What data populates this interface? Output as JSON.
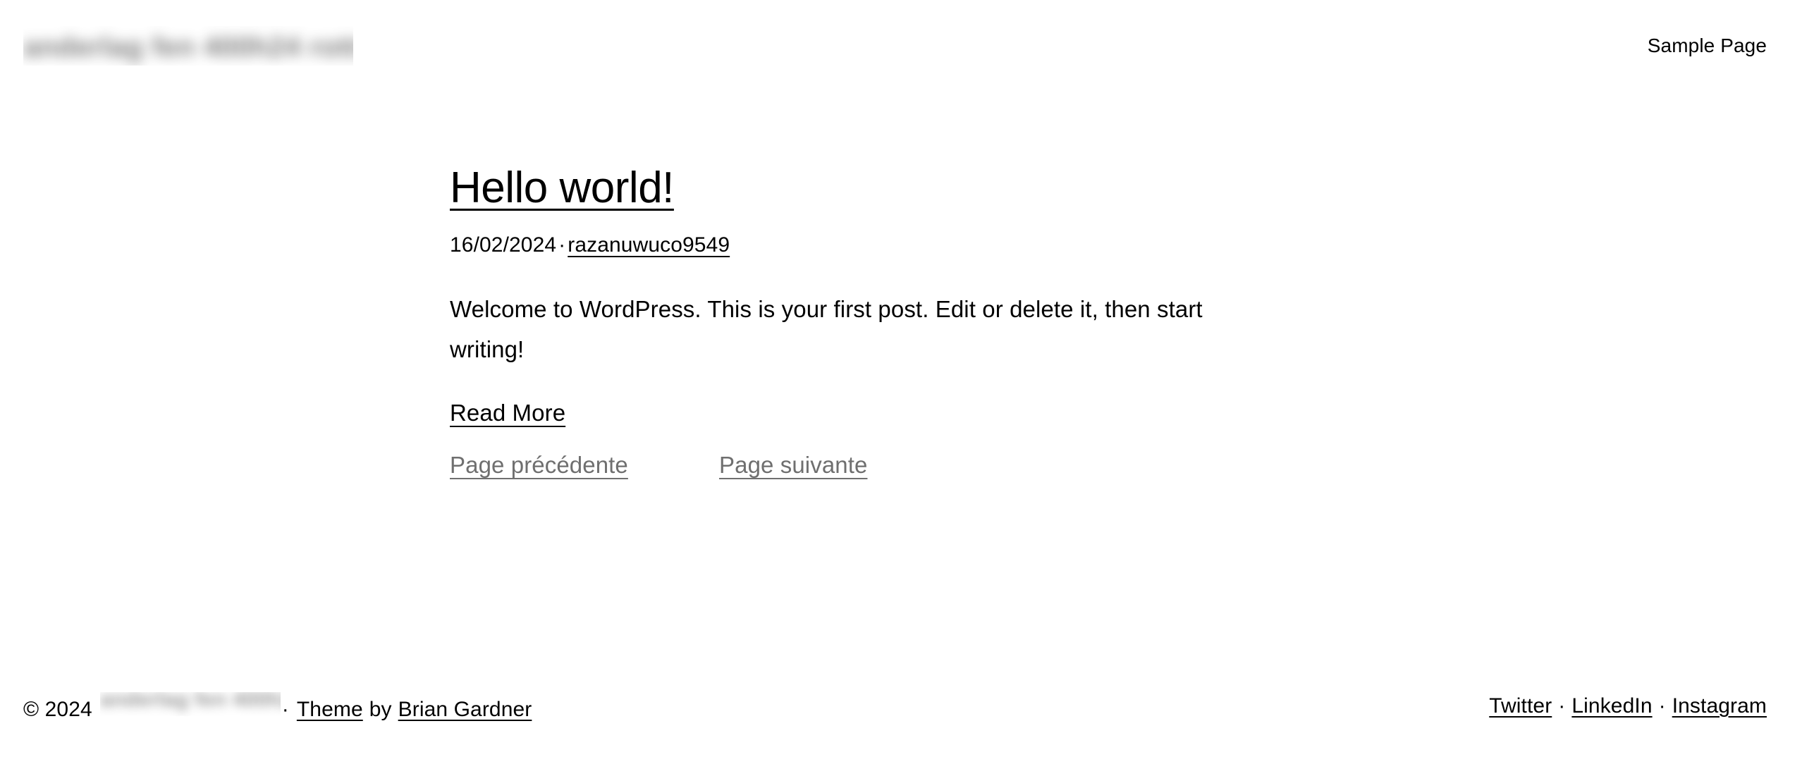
{
  "header": {
    "site_title_redacted": "anderlag fen 400h24 rottsep ep",
    "site_title_is_blurred": true,
    "nav": {
      "items": [
        {
          "label": "Sample Page"
        }
      ]
    }
  },
  "main": {
    "post": {
      "title": "Hello world!",
      "date": "16/02/2024",
      "meta_separator": "·",
      "author": "razanuwuco9549",
      "excerpt": "Welcome to WordPress. This is your first post. Edit or delete it, then start writing!",
      "read_more_label": "Read More"
    },
    "pagination": {
      "previous_label": "Page précédente",
      "next_label": "Page suivante"
    }
  },
  "footer": {
    "copyright_year": "© 2024",
    "site_name_redacted": "anderlag fen 400h24 rottsep ep",
    "site_name_is_blurred": true,
    "separator": "·",
    "theme_label": "Theme",
    "by_label": "by",
    "theme_author": "Brian Gardner",
    "social": {
      "separator": "·",
      "links": [
        {
          "label": "Twitter"
        },
        {
          "label": "LinkedIn"
        },
        {
          "label": "Instagram"
        }
      ]
    }
  },
  "colors": {
    "background": "#ffffff",
    "text": "#000000",
    "muted_text": "#6f6f6f",
    "redaction": "#5a5a5a"
  }
}
